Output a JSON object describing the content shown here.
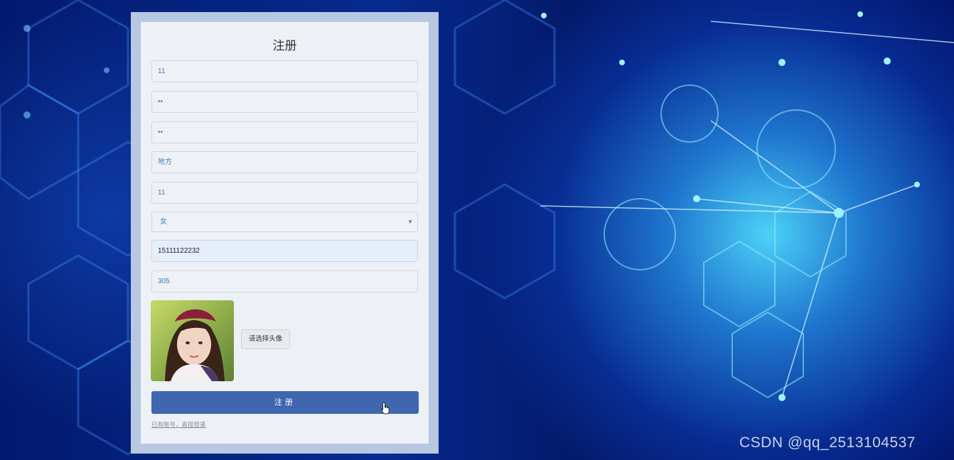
{
  "form": {
    "title": "注册",
    "fields": [
      {
        "value": "11"
      },
      {
        "value": "••"
      },
      {
        "value": "••"
      },
      {
        "value": "地方"
      },
      {
        "value": "11"
      },
      {
        "value": "女"
      },
      {
        "value": "15111122232"
      },
      {
        "value": "305"
      }
    ],
    "file_button_label": "请选择头像",
    "submit_label": "注册",
    "login_link": "已有账号，直接登录"
  },
  "watermark": "CSDN @qq_2513104537",
  "colors": {
    "primary_button": "#4066b0",
    "panel": "#edf0f5",
    "panel_border": "#b8c7e2",
    "background": "#062a8f"
  }
}
